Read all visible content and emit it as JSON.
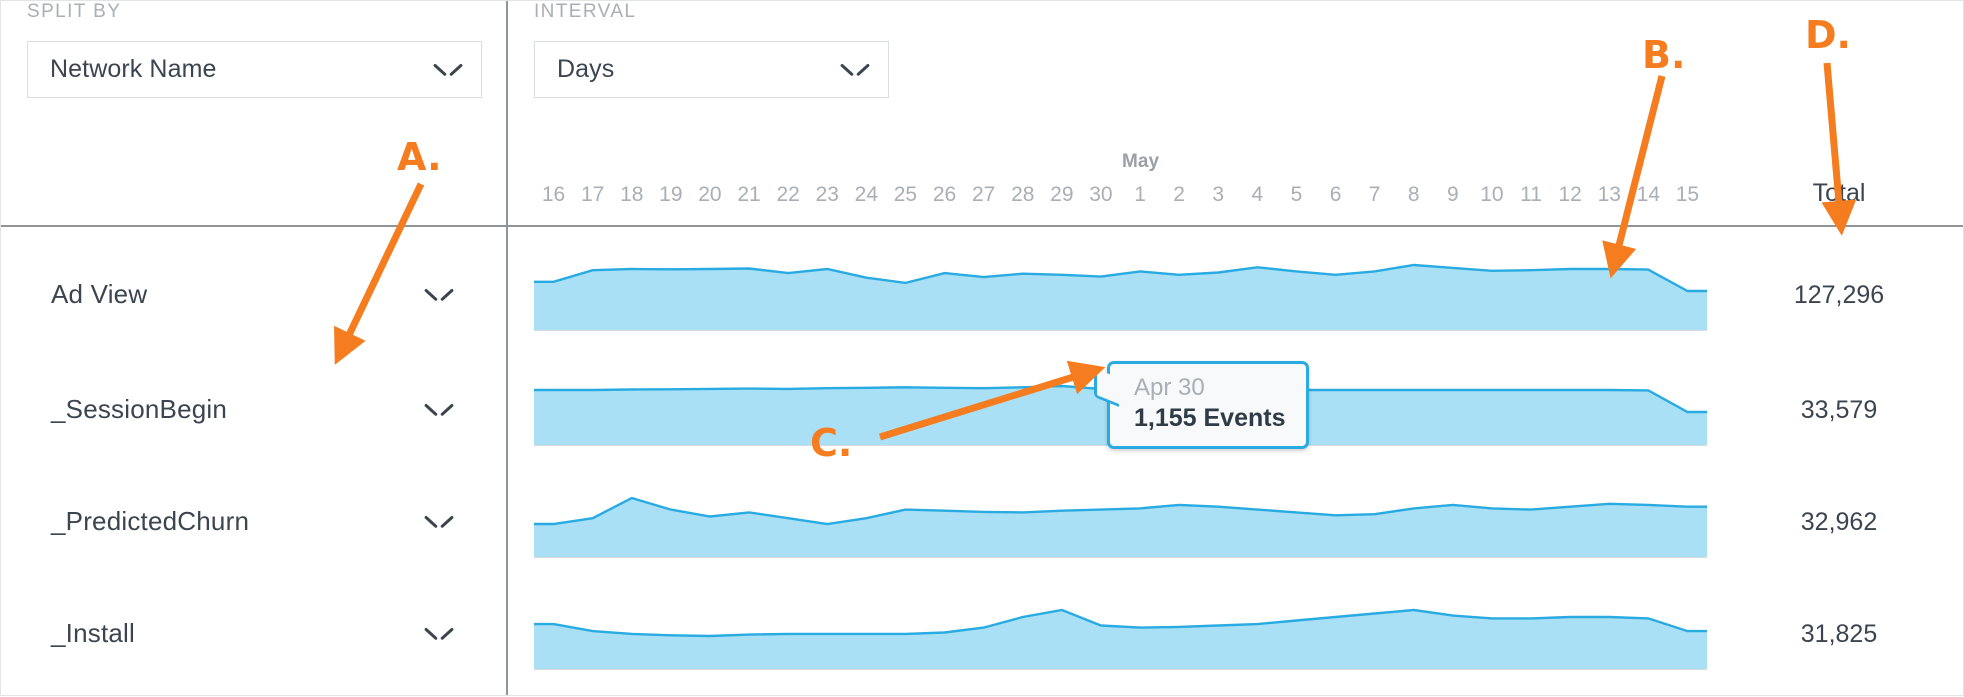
{
  "controls": {
    "split_by": {
      "label": "SPLIT BY",
      "value": "Network Name",
      "icon": "chevron-down-icon"
    },
    "interval": {
      "label": "INTERVAL",
      "value": "Days",
      "icon": "chevron-down-icon"
    }
  },
  "table": {
    "total_header": "Total",
    "rows": [
      {
        "name": "Ad View",
        "total": "127,296"
      },
      {
        "name": "_SessionBegin",
        "total": "33,579"
      },
      {
        "name": "_PredictedChurn",
        "total": "32,962"
      },
      {
        "name": "_Install",
        "total": "31,825"
      }
    ]
  },
  "tooltip": {
    "date": "Apr 30",
    "value": "1,155 Events"
  },
  "annotations": [
    {
      "id": "A",
      "label": "A."
    },
    {
      "id": "B",
      "label": "B."
    },
    {
      "id": "C",
      "label": "C."
    },
    {
      "id": "D",
      "label": "D."
    }
  ],
  "colors": {
    "accent_blue": "#29abe2",
    "area_fill": "#a9e0f5",
    "annotation_orange": "#f57c1f",
    "text": "#3b4550",
    "muted": "#a9afb5"
  },
  "chart_data": {
    "type": "area",
    "title": "",
    "xlabel": "",
    "ylabel": "Events",
    "grid": false,
    "legend_position": "none",
    "month_markers": [
      {
        "label": "May",
        "x_index": 15
      }
    ],
    "categories": [
      "16",
      "17",
      "18",
      "19",
      "20",
      "21",
      "22",
      "23",
      "24",
      "25",
      "26",
      "27",
      "28",
      "29",
      "30",
      "1",
      "2",
      "3",
      "4",
      "5",
      "6",
      "7",
      "8",
      "9",
      "10",
      "11",
      "12",
      "13",
      "14",
      "15"
    ],
    "series": [
      {
        "name": "Ad View",
        "total": 127296,
        "values": [
          4180,
          4380,
          4400,
          4395,
          4400,
          4410,
          4330,
          4400,
          4250,
          4160,
          4330,
          4260,
          4320,
          4300,
          4270,
          4360,
          4300,
          4340,
          4430,
          4360,
          4300,
          4360,
          4470,
          4420,
          4370,
          4380,
          4400,
          4400,
          4390,
          4020
        ]
      },
      {
        "name": "_SessionBegin",
        "total": 33579,
        "values": [
          1150,
          1150,
          1152,
          1153,
          1155,
          1156,
          1155,
          1158,
          1160,
          1162,
          1160,
          1158,
          1162,
          1168,
          1155,
          1148,
          1150,
          1150,
          1150,
          1150,
          1150,
          1150,
          1150,
          1150,
          1150,
          1150,
          1150,
          1150,
          1148,
          1050
        ]
      },
      {
        "name": "_PredictedChurn",
        "total": 32962,
        "values": [
          1085,
          1095,
          1130,
          1110,
          1098,
          1105,
          1095,
          1085,
          1095,
          1110,
          1108,
          1106,
          1105,
          1108,
          1110,
          1112,
          1118,
          1115,
          1110,
          1105,
          1100,
          1102,
          1112,
          1118,
          1112,
          1110,
          1115,
          1120,
          1118,
          1115
        ]
      },
      {
        "name": "_Install",
        "total": 31825,
        "values": [
          1050,
          1040,
          1036,
          1034,
          1033,
          1035,
          1036,
          1036,
          1036,
          1036,
          1038,
          1045,
          1060,
          1070,
          1048,
          1045,
          1046,
          1048,
          1050,
          1055,
          1060,
          1065,
          1070,
          1062,
          1058,
          1058,
          1060,
          1060,
          1058,
          1040
        ]
      }
    ],
    "highlight_point": {
      "series": "_SessionBegin",
      "category": "30",
      "label": "Apr 30",
      "value": 1155,
      "value_label": "1,155 Events"
    }
  }
}
